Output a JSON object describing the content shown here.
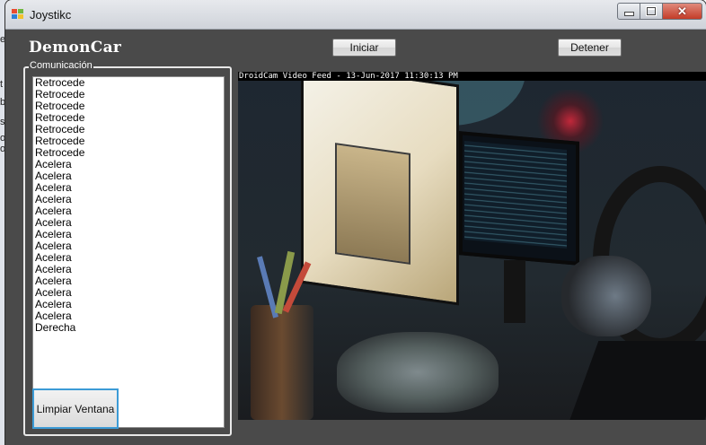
{
  "window": {
    "title": "Joystikc"
  },
  "header": {
    "app_title": "DemonCar",
    "start_label": "Iniciar",
    "stop_label": "Detener"
  },
  "communication": {
    "group_label": "Comunicación",
    "messages": [
      "Retrocede",
      "Retrocede",
      "Retrocede",
      "Retrocede",
      "Retrocede",
      "Retrocede",
      "Retrocede",
      "Acelera",
      "Acelera",
      "Acelera",
      "Acelera",
      "Acelera",
      "Acelera",
      "Acelera",
      "Acelera",
      "Acelera",
      "Acelera",
      "Acelera",
      "Acelera",
      "Acelera",
      "Acelera",
      "Derecha"
    ],
    "clear_label": "Limpiar Ventana"
  },
  "video": {
    "caption": "DroidCam Video Feed - 13-Jun-2017 11:30:13 PM"
  },
  "desktop": {
    "edge_glyphs": [
      "e",
      "t",
      "b",
      "s",
      "of",
      "of"
    ]
  }
}
